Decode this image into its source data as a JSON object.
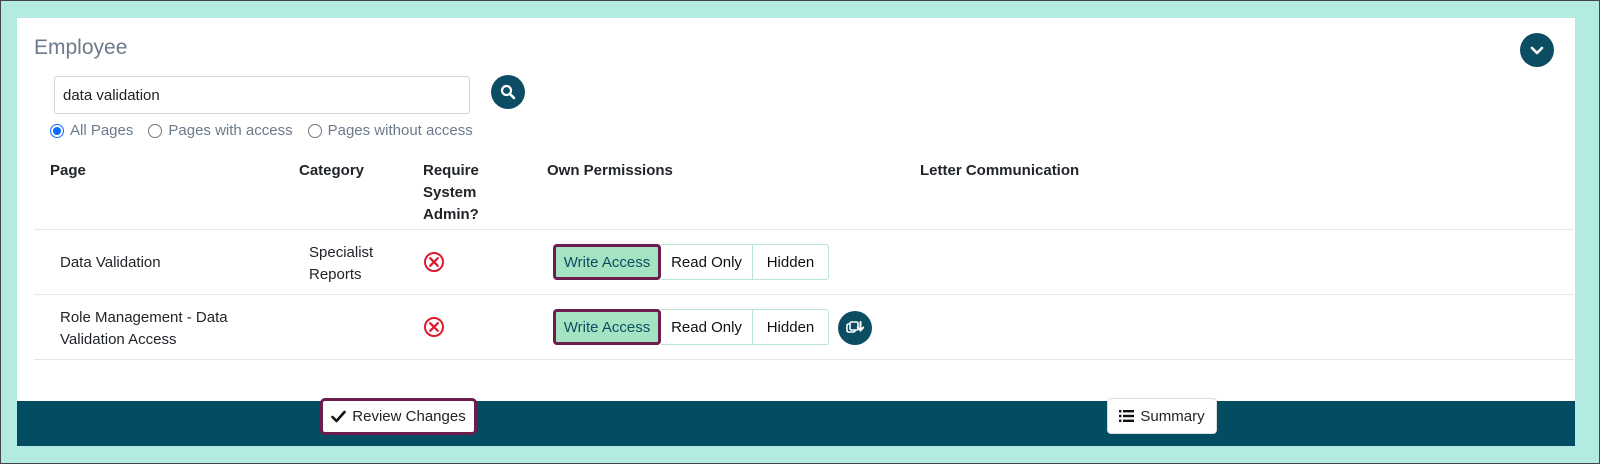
{
  "panel": {
    "title": "Employee"
  },
  "search": {
    "value": "data validation"
  },
  "filters": {
    "options": [
      "All Pages",
      "Pages with access",
      "Pages without access"
    ],
    "selected": "All Pages"
  },
  "table": {
    "headers": {
      "page": "Page",
      "category": "Category",
      "require_admin_1": "Require",
      "require_admin_2": "System",
      "require_admin_3": "Admin?",
      "own_permissions": "Own Permissions",
      "letter_communication": "Letter Communication"
    },
    "rows": [
      {
        "page_1": "Data Validation",
        "category_1": "Specialist",
        "category_2": "Reports",
        "require_admin": "no",
        "permission_selected": "Write Access"
      },
      {
        "page_1": "Role Management - Data",
        "page_2": "Validation Access",
        "require_admin": "no",
        "permission_selected": "Write Access"
      }
    ],
    "permission_options": {
      "write": "Write Access",
      "read": "Read Only",
      "hidden": "Hidden"
    }
  },
  "footer": {
    "review_label": "Review Changes",
    "summary_label": "Summary"
  },
  "colors": {
    "background": "#b3ebe3",
    "primary": "#0d4d63",
    "active_button": "#a6e3c2",
    "active_border": "#6b1d4e",
    "error": "#e0192d"
  }
}
